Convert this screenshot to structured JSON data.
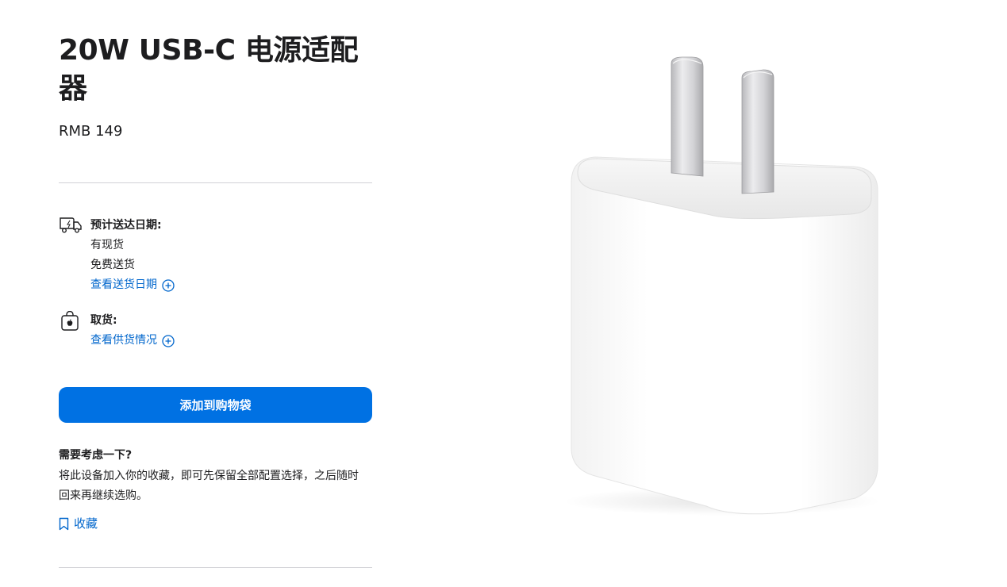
{
  "product": {
    "title": "20W USB-C 电源适配器",
    "price": "RMB 149"
  },
  "delivery": {
    "icon": "delivery-truck-icon",
    "heading": "预计送达日期:",
    "stock": "有现货",
    "shipping": "免费送货",
    "link": "查看送货日期"
  },
  "pickup": {
    "icon": "apple-store-bag-icon",
    "heading": "取货:",
    "link": "查看供货情况"
  },
  "actions": {
    "add_to_bag": "添加到购物袋"
  },
  "consider": {
    "title": "需要考虑一下?",
    "text": "将此设备加入你的收藏，即可先保留全部配置选择，之后随时回来再继续选购。",
    "save_link": "收藏",
    "save_icon": "bookmark-icon"
  },
  "image": {
    "subject": "white-power-adapter"
  },
  "colors": {
    "accent": "#0071e3",
    "link": "#0066cc",
    "text": "#1d1d1f",
    "divider": "#d2d2d7"
  }
}
